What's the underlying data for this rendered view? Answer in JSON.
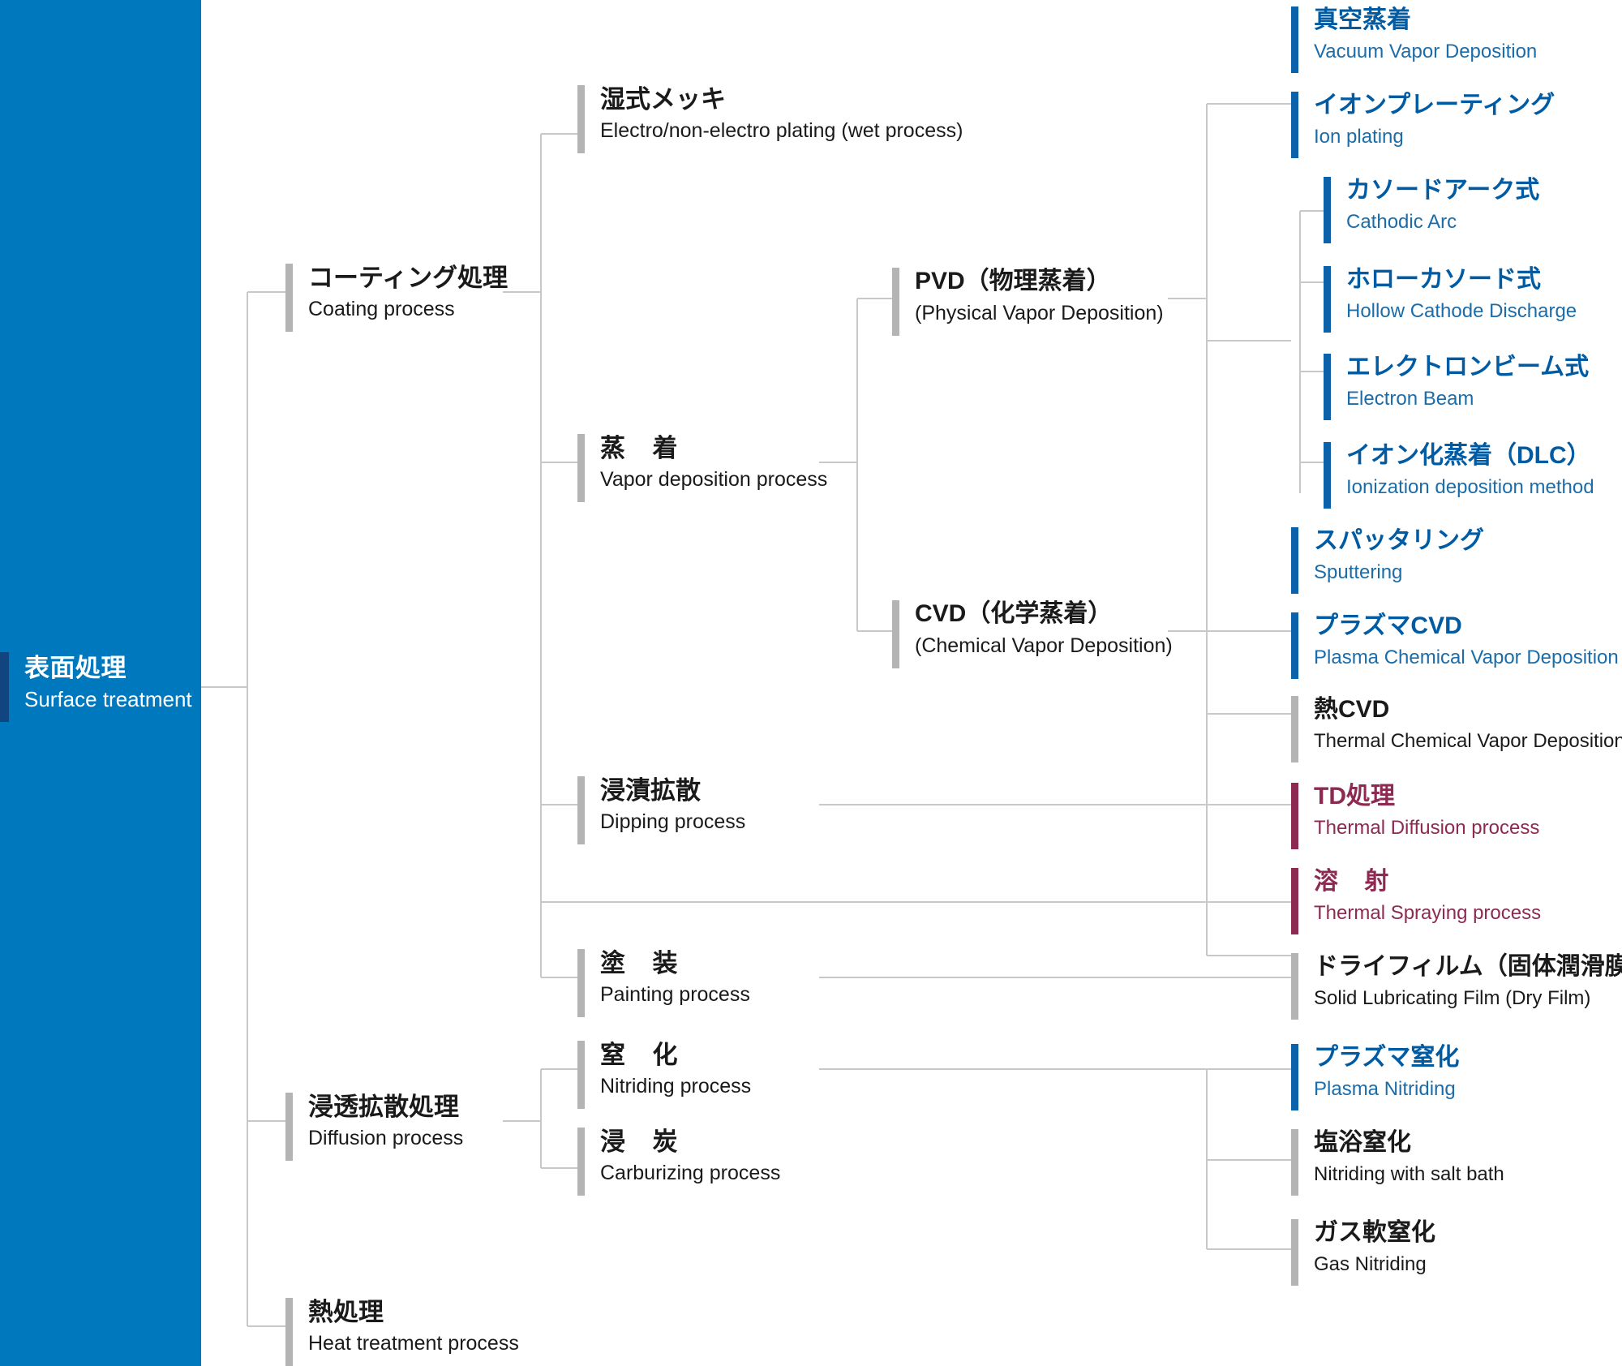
{
  "diagram": {
    "title_jp": "表面処理",
    "title_en": "Surface treatment",
    "colors": {
      "panel_blue": "#0078be",
      "root_accent": "#11457f",
      "blue_text": "#005ba3",
      "blue_bar": "#0b62ab",
      "maroon": "#8c2a52",
      "black_text": "#1a1a1a",
      "gray_bar": "#b4b4b4",
      "wire": "#c8c8c8"
    }
  },
  "nodes": {
    "coating": {
      "jp": "コーティング処理",
      "en": "Coating process"
    },
    "diffusion": {
      "jp": "浸透拡散処理",
      "en": "Diffusion process"
    },
    "heat": {
      "jp": "熱処理",
      "en": "Heat treatment process"
    },
    "wet_plating": {
      "jp": "湿式メッキ",
      "en": "Electro/non-electro plating (wet process)"
    },
    "vapor": {
      "jp": "蒸　着",
      "en": "Vapor deposition process"
    },
    "dipping": {
      "jp": "浸漬拡散",
      "en": "Dipping process"
    },
    "painting": {
      "jp": "塗　装",
      "en": "Painting process"
    },
    "nitriding": {
      "jp": "窒　化",
      "en": "Nitriding process"
    },
    "carburizing": {
      "jp": "浸　炭",
      "en": "Carburizing process"
    },
    "pvd": {
      "jp": "PVD（物理蒸着）",
      "en": "(Physical Vapor Deposition)"
    },
    "cvd": {
      "jp": "CVD（化学蒸着）",
      "en": "(Chemical Vapor Deposition)"
    },
    "vacuum_vapor": {
      "jp": "真空蒸着",
      "en": "Vacuum Vapor Deposition"
    },
    "ion_plating": {
      "jp": "イオンプレーティング",
      "en": "Ion plating"
    },
    "cathodic_arc": {
      "jp": "カソードアーク式",
      "en": "Cathodic Arc"
    },
    "hollow_cathode": {
      "jp": "ホローカソード式",
      "en": "Hollow Cathode Discharge"
    },
    "electron_beam": {
      "jp": "エレクトロンビーム式",
      "en": "Electron Beam"
    },
    "dlc": {
      "jp": "イオン化蒸着（DLC）",
      "en": "Ionization deposition method"
    },
    "sputtering": {
      "jp": "スパッタリング",
      "en": "Sputtering"
    },
    "plasma_cvd": {
      "jp": "プラズマCVD",
      "en": "Plasma Chemical Vapor Deposition"
    },
    "thermal_cvd": {
      "jp": "熱CVD",
      "en": "Thermal Chemical Vapor Deposition"
    },
    "td": {
      "jp": "TD処理",
      "en": "Thermal Diffusion process"
    },
    "spraying": {
      "jp": "溶　射",
      "en": "Thermal Spraying process"
    },
    "dry_film": {
      "jp": "ドライフィルム（固体潤滑膜）",
      "en": "Solid Lubricating Film (Dry Film)"
    },
    "plasma_nitriding": {
      "jp": "プラズマ窒化",
      "en": "Plasma Nitriding"
    },
    "salt_bath": {
      "jp": "塩浴窒化",
      "en": "Nitriding with salt bath"
    },
    "gas_nitriding": {
      "jp": "ガス軟窒化",
      "en": "Gas Nitriding"
    }
  }
}
